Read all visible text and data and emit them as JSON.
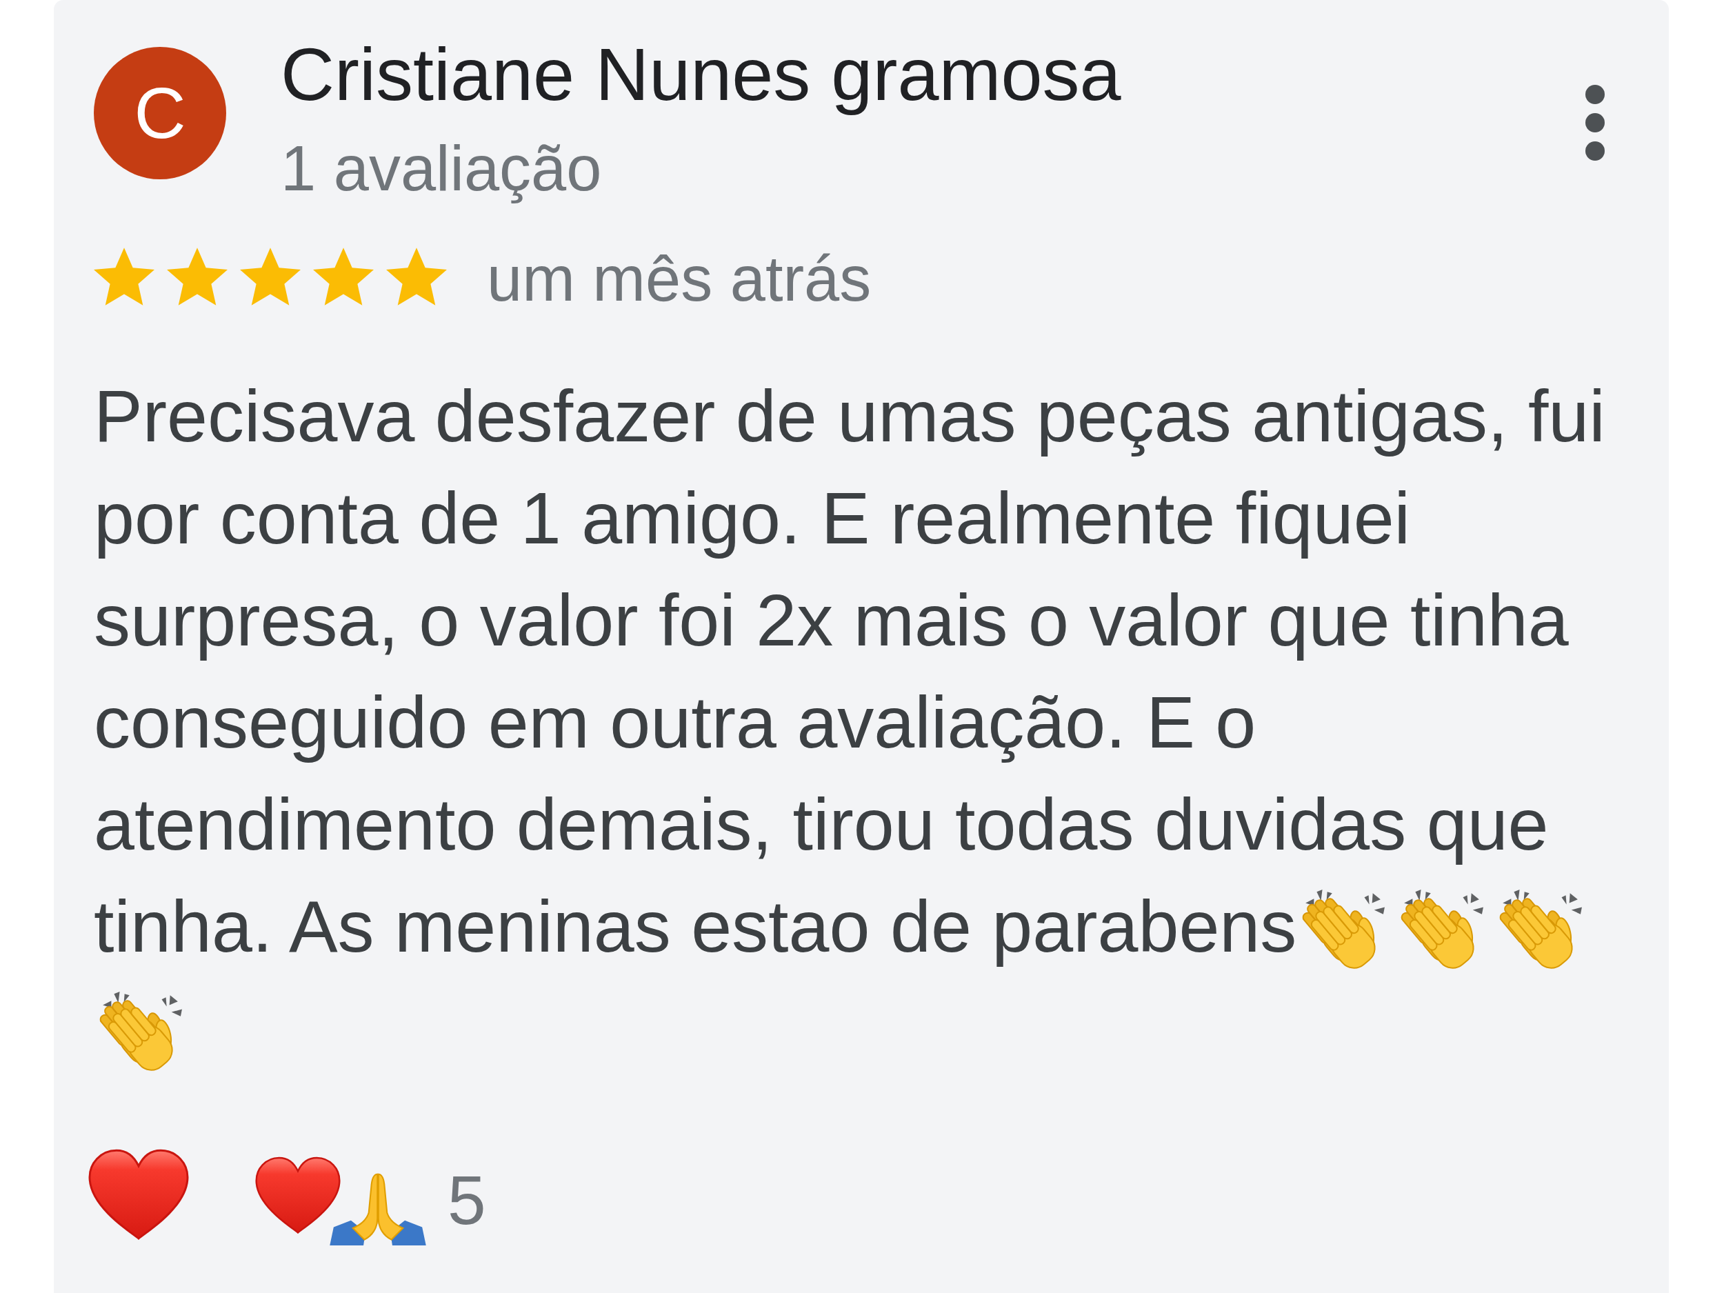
{
  "review": {
    "author": {
      "avatar_initial": "C",
      "name": "Cristiane Nunes gramosa",
      "review_count": "1 avaliação"
    },
    "stars": 5,
    "time": "um mês atrás",
    "text": "Precisava desfazer de umas peças antigas, fui por conta de 1 amigo. E realmente fiquei surpresa, o valor foi 2x mais o valor que tinha conseguido em outra avaliação. E o atendimento demais, tirou todas duvidas que tinha. As meninas estao de parabens",
    "text_emojis": [
      {
        "kind": "clap"
      },
      {
        "kind": "clap"
      },
      {
        "kind": "clap"
      },
      {
        "kind": "clap"
      }
    ]
  },
  "reactions": {
    "react_button": {
      "kind": "heart"
    },
    "summary_emojis": [
      {
        "kind": "heart"
      },
      {
        "kind": "pray"
      }
    ],
    "count": "5"
  }
}
